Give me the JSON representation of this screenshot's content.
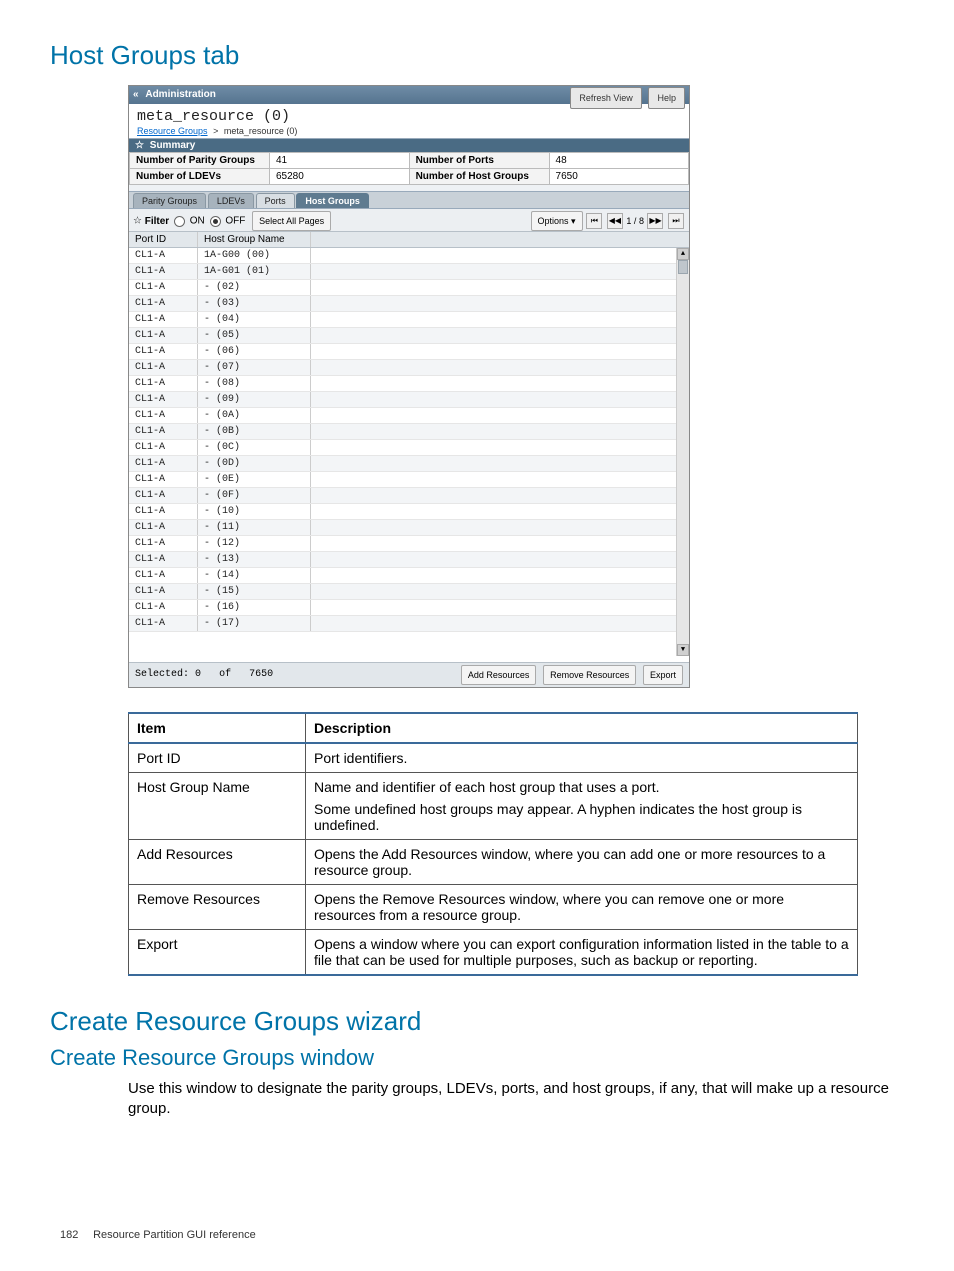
{
  "heading1": "Host Groups tab",
  "topbar": {
    "chev": "«",
    "brand": "Administration",
    "refresh": "Refresh View",
    "help": "Help"
  },
  "title": "meta_resource (0)",
  "crumb_link": "Resource Groups",
  "crumb_sep": ">",
  "crumb_cur": "meta_resource (0)",
  "summary_label": "Summary",
  "summary": [
    {
      "l1": "Number of Parity Groups",
      "v1": "41",
      "l2": "Number of Ports",
      "v2": "48"
    },
    {
      "l1": "Number of LDEVs",
      "v1": "65280",
      "l2": "Number of Host Groups",
      "v2": "7650"
    }
  ],
  "tabs": {
    "pg": "Parity Groups",
    "ldev": "LDEVs",
    "ports": "Ports",
    "hg": "Host Groups"
  },
  "toolbar": {
    "filter": "Filter",
    "on": "ON",
    "off": "OFF",
    "select_all": "Select All Pages",
    "options": "Options",
    "page_cur": "1",
    "page_sep": "/",
    "page_total": "8"
  },
  "gridhead": {
    "c1": "Port ID",
    "c2": "Host Group Name"
  },
  "rows": [
    {
      "p": "CL1-A",
      "h": "1A-G00 (00)"
    },
    {
      "p": "CL1-A",
      "h": "1A-G01 (01)"
    },
    {
      "p": "CL1-A",
      "h": "- (02)"
    },
    {
      "p": "CL1-A",
      "h": "- (03)"
    },
    {
      "p": "CL1-A",
      "h": "- (04)"
    },
    {
      "p": "CL1-A",
      "h": "- (05)"
    },
    {
      "p": "CL1-A",
      "h": "- (06)"
    },
    {
      "p": "CL1-A",
      "h": "- (07)"
    },
    {
      "p": "CL1-A",
      "h": "- (08)"
    },
    {
      "p": "CL1-A",
      "h": "- (09)"
    },
    {
      "p": "CL1-A",
      "h": "- (0A)"
    },
    {
      "p": "CL1-A",
      "h": "- (0B)"
    },
    {
      "p": "CL1-A",
      "h": "- (0C)"
    },
    {
      "p": "CL1-A",
      "h": "- (0D)"
    },
    {
      "p": "CL1-A",
      "h": "- (0E)"
    },
    {
      "p": "CL1-A",
      "h": "- (0F)"
    },
    {
      "p": "CL1-A",
      "h": "- (10)"
    },
    {
      "p": "CL1-A",
      "h": "- (11)"
    },
    {
      "p": "CL1-A",
      "h": "- (12)"
    },
    {
      "p": "CL1-A",
      "h": "- (13)"
    },
    {
      "p": "CL1-A",
      "h": "- (14)"
    },
    {
      "p": "CL1-A",
      "h": "- (15)"
    },
    {
      "p": "CL1-A",
      "h": "- (16)"
    },
    {
      "p": "CL1-A",
      "h": "- (17)"
    }
  ],
  "footbar": {
    "selected_lbl": "Selected:",
    "selected_n": "0",
    "of": "of",
    "total": "7650",
    "add": "Add Resources",
    "remove": "Remove Resources",
    "export": "Export"
  },
  "desc_head": {
    "item": "Item",
    "desc": "Description"
  },
  "desc_rows": [
    {
      "item": "Port ID",
      "desc": "Port identifiers."
    },
    {
      "item": "Host Group Name",
      "desc": "Name and identifier of each host group that uses a port.\nSome undefined host groups may appear. A hyphen indicates the host group is undefined."
    },
    {
      "item": "Add Resources",
      "desc": "Opens the Add Resources window, where you can add one or more resources to a resource group."
    },
    {
      "item": "Remove Resources",
      "desc": "Opens the Remove Resources window, where you can remove one or more resources from a resource group."
    },
    {
      "item": "Export",
      "desc": "Opens a window where you can export configuration information listed in the table to a file that can be used for multiple purposes, such as backup or reporting."
    }
  ],
  "heading2": "Create Resource Groups wizard",
  "heading3": "Create Resource Groups window",
  "para1": "Use this window to designate the parity groups, LDEVs, ports, and host groups, if any, that will make up a resource group.",
  "footer_page": "182",
  "footer_text": "Resource Partition GUI reference"
}
